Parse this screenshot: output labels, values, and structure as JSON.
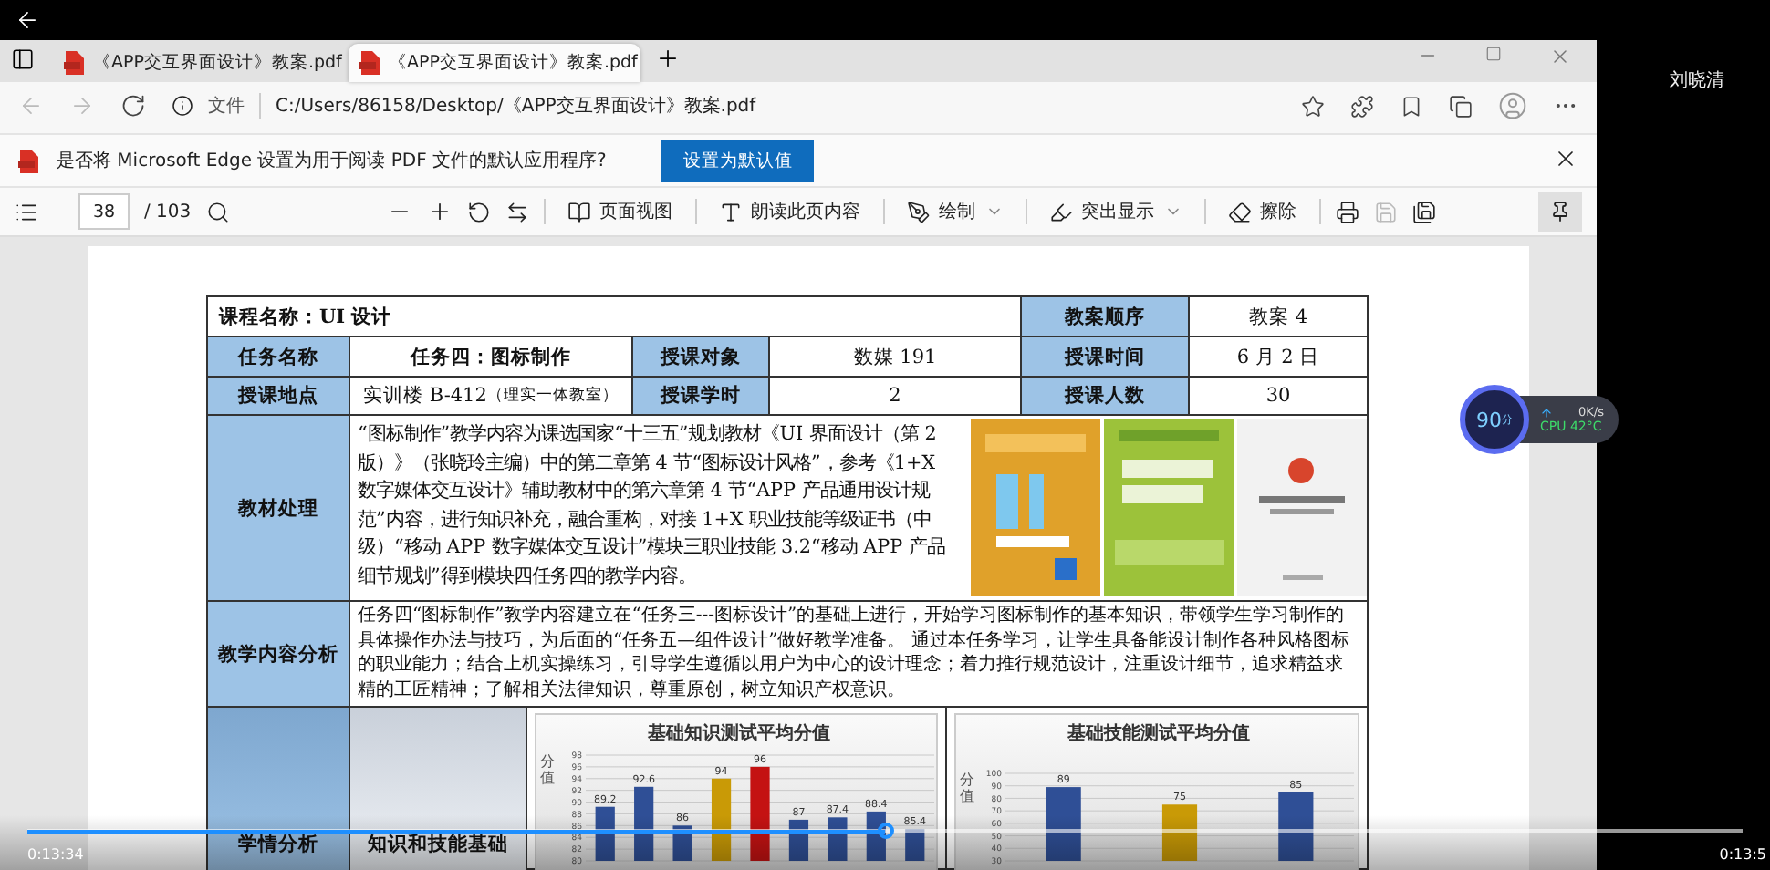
{
  "browser": {
    "tabs": [
      {
        "title": "《APP交互界面设计》教案.pdf",
        "selected": false
      },
      {
        "title": "《APP交互界面设计》教案.pdf",
        "selected": true
      }
    ],
    "address": {
      "scheme": "文件",
      "url": "C:/Users/86158/Desktop/《APP交互界面设计》教案.pdf"
    },
    "infobar": {
      "message": "是否将 Microsoft Edge 设置为用于阅读 PDF 文件的默认应用程序?",
      "button": "设置为默认值"
    },
    "pdf_toolbar": {
      "page": "38",
      "page_count": "/ 103",
      "tools": [
        {
          "label": "页面视图",
          "dropdown": false
        },
        {
          "label": "朗读此页内容",
          "dropdown": false
        },
        {
          "label": "绘制",
          "dropdown": true
        },
        {
          "label": "突出显示",
          "dropdown": true
        },
        {
          "label": "擦除",
          "dropdown": false
        }
      ],
      "pinned": true
    }
  },
  "user_name": "刘晓清",
  "lesson_plan": {
    "course_name": "课程名称：UI 设计",
    "order": {
      "label": "教案顺序",
      "value": "教案 4"
    },
    "info_rows": [
      [
        {
          "label": "任务名称",
          "value": "任务四：图标制作",
          "bold": true
        },
        {
          "label": "授课对象",
          "value": "数媒 191",
          "bold": false
        },
        {
          "label": "授课时间",
          "value": "6 月 2 日",
          "bold": false
        }
      ],
      [
        {
          "label": "授课地点",
          "value": "实训楼 B-412",
          "note": "（理实一体教室）",
          "bold": false
        },
        {
          "label": "授课学时",
          "value": "2",
          "bold": false
        },
        {
          "label": "授课人数",
          "value": "30",
          "bold": false
        }
      ]
    ],
    "materials": {
      "label": "教材处理",
      "text": "“图标制作”教学内容为课选国家“十三五”规划教材《UI 界面设计（第 2 版）》（张晓玲主编）中的第二章第 4 节“图标设计风格”，参考《1+X 数字媒体交互设计》辅助教材中的第六章第 4 节“APP 产品通用设计规范”内容，进行知识补充，融合重构，对接 1+X 职业技能等级证书（中级）“移动 APP 数字媒体交互设计”模块三职业技能 3.2“移动 APP 产品细节规划”得到模块四任务四的教学内容。"
    },
    "content": {
      "label": "教学内容分析",
      "text": "任务四“图标制作”教学内容建立在“任务三---图标设计”的基础上进行，开始学习图标制作的基本知识，带领学生学习制作的具体操作办法与技巧，为后面的“任务五—组件设计”做好教学准备。 通过本任务学习，让学生具备能设计制作各种风格图标的职业能力；结合上机实操练习，引导学生遵循以用户为中心的设计理念；着力推行规范设计，注重设计细节，追求精益求精的工匠精神；了解相关法律知识，尊重原创，树立知识产权意识。"
    },
    "analysis": {
      "label": "学情分析",
      "sublabel": "知识和技能基础",
      "charts": [
        {
          "chart_data": {
            "type": "bar",
            "grid": true,
            "title": "基础知识测试平均分值",
            "ylabel": "分值",
            "ylim": [
              80,
              98
            ],
            "yticks": [
              80,
              82,
              84,
              86,
              88,
              90,
              92,
              94,
              96,
              98
            ],
            "data_labels": true,
            "values": [
              89.2,
              92.6,
              86,
              94,
              96,
              87,
              87.4,
              88.4,
              85.4
            ],
            "colors": [
              "#2f4f96",
              "#2f4f96",
              "#2f4f96",
              "#c99a06",
              "#c41212",
              "#2f4f96",
              "#2f4f96",
              "#2f4f96",
              "#2f4f96"
            ]
          }
        },
        {
          "chart_data": {
            "type": "bar",
            "grid": true,
            "title": "基础技能测试平均分值",
            "ylabel": "分值",
            "ylim": [
              30,
              100
            ],
            "yticks": [
              30,
              40,
              50,
              60,
              70,
              80,
              90,
              100
            ],
            "data_labels": true,
            "values": [
              89,
              75,
              85
            ],
            "colors": [
              "#2f4f96",
              "#c99a06",
              "#2f4f96"
            ]
          }
        }
      ]
    }
  },
  "monitor": {
    "score": "90",
    "unit": "分",
    "speed": "0K/s",
    "cpu": "CPU 42°C"
  },
  "video": {
    "elapsed": "0:13:34",
    "duration": "0:13:5",
    "level": 0.5
  }
}
